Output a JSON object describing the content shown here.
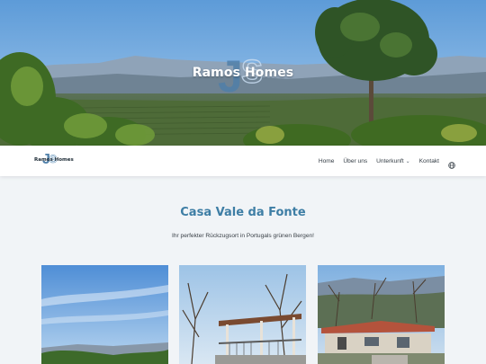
{
  "hero": {
    "brand_name": "Ramos Homes"
  },
  "nav": {
    "logo_text": "Ramos Homes",
    "items": [
      {
        "label": "Home"
      },
      {
        "label": "Über uns"
      },
      {
        "label": "Unterkunft",
        "chevron": "chevron-down-icon"
      },
      {
        "label": "Kontakt"
      }
    ],
    "language_icon": "globe-icon"
  },
  "main": {
    "title": "Casa Vale da Fonte",
    "subtitle": "Ihr perfekter Rückzugsort in Portugals grünen Bergen!"
  },
  "colors": {
    "accent": "#3e7ea5",
    "background": "#f1f4f7",
    "nav_background": "#ffffff"
  }
}
